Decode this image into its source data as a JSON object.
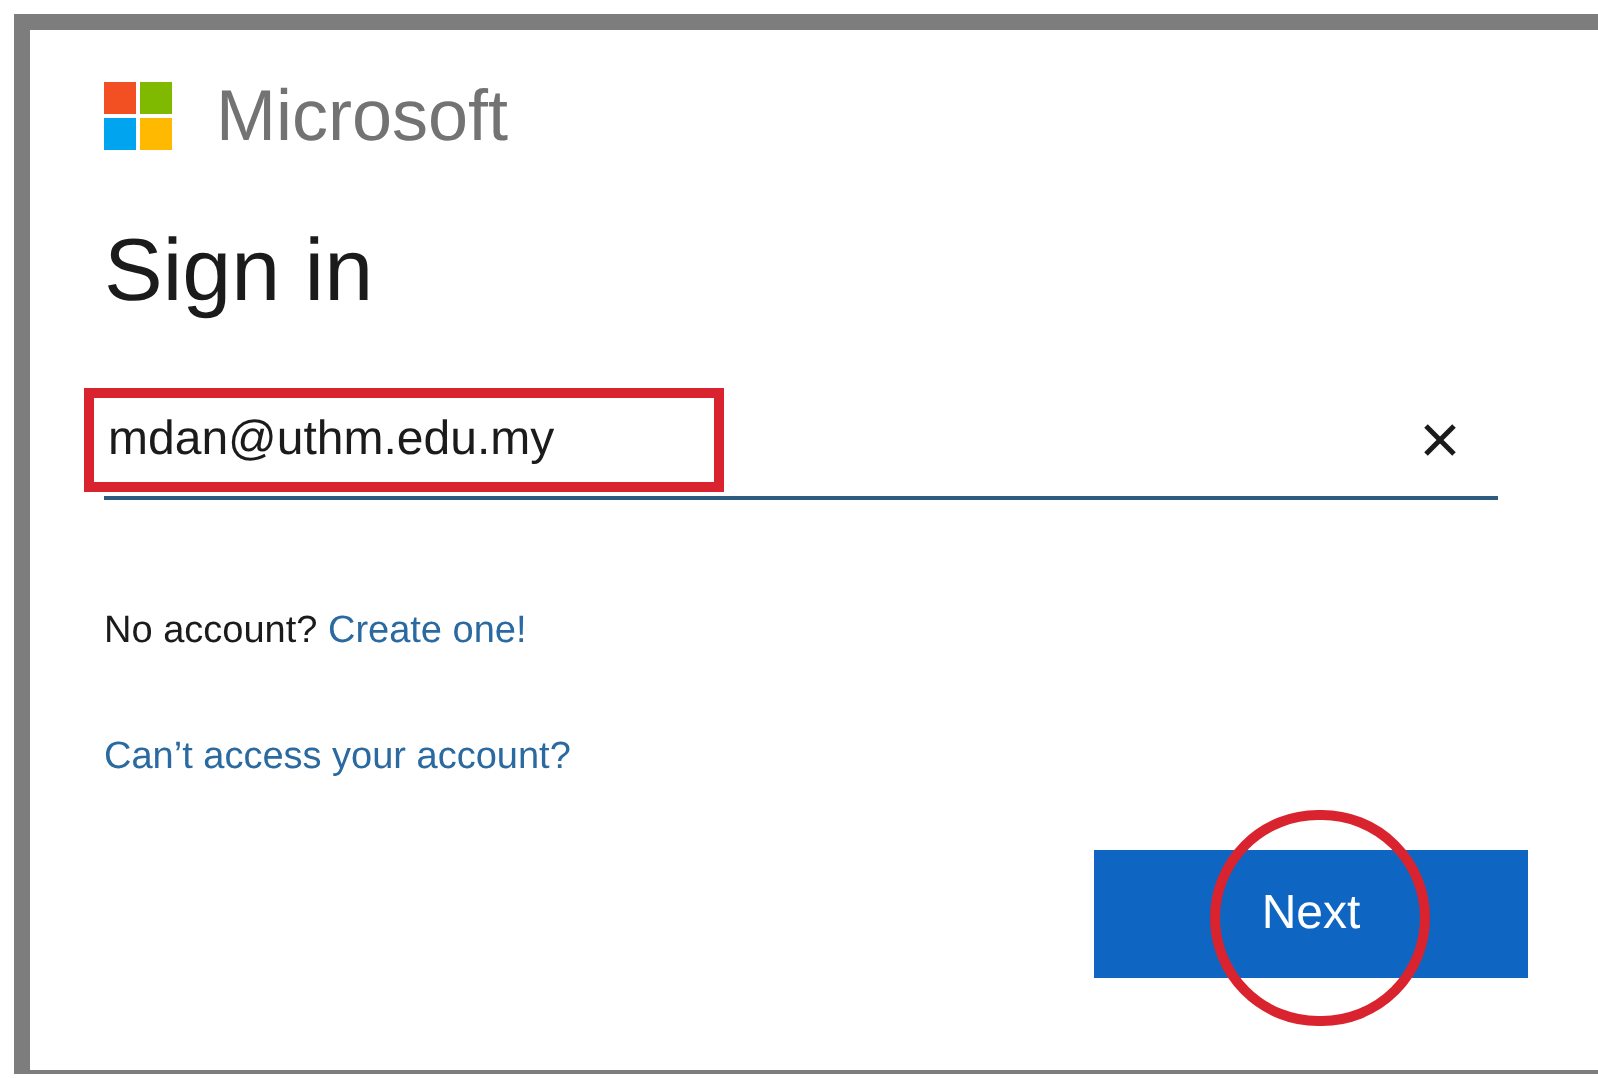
{
  "brand": {
    "name": "Microsoft"
  },
  "heading": "Sign in",
  "email_field": {
    "value": "mdan@uthm.edu.my",
    "highlighted": true
  },
  "no_account": {
    "text": "No account?",
    "link": "Create one!"
  },
  "access_link": "Can’t access your account?",
  "next_button": {
    "label": "Next",
    "highlighted": true
  }
}
